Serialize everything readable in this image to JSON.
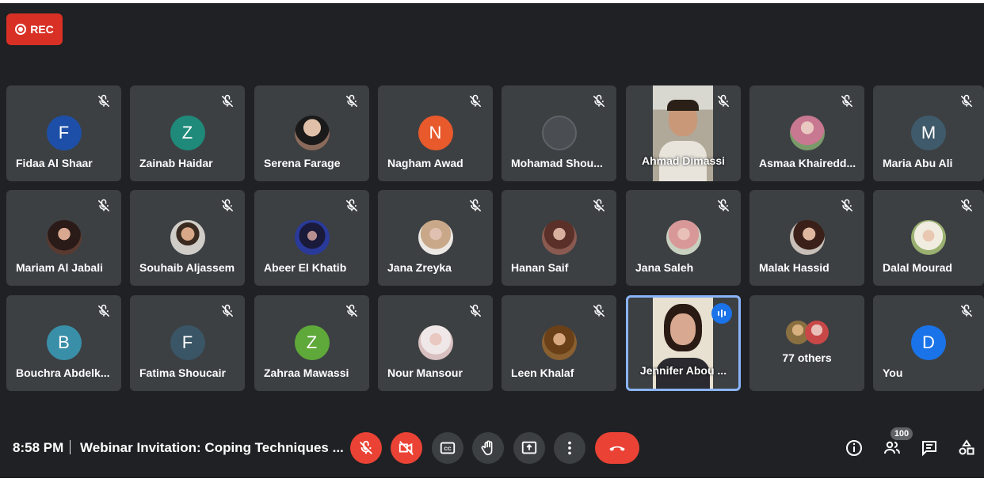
{
  "recording": {
    "label": "REC"
  },
  "participants": [
    {
      "name": "Fidaa Al Shaar",
      "avatar_letter": "F",
      "color": "#1e4fa8",
      "kind": "letter"
    },
    {
      "name": "Zainab Haidar",
      "avatar_letter": "Z",
      "color": "#1f8a7a",
      "kind": "letter"
    },
    {
      "name": "Serena Farage",
      "kind": "photo",
      "photo_color": "#8a6a5a"
    },
    {
      "name": "Nagham Awad",
      "avatar_letter": "N",
      "color": "#e8592c",
      "kind": "letter"
    },
    {
      "name": "Mohamad Shou...",
      "kind": "blank",
      "color": "#4a4d51"
    },
    {
      "name": "Ahmad Dimassi",
      "kind": "video"
    },
    {
      "name": "Asmaa Khairedd...",
      "kind": "photo",
      "photo_color": "#7a9a6a"
    },
    {
      "name": "Maria Abu Ali",
      "avatar_letter": "M",
      "color": "#3f5a6a",
      "kind": "letter"
    },
    {
      "name": "Mariam Al Jabali",
      "kind": "photo",
      "photo_color": "#5a3a30"
    },
    {
      "name": "Souhaib Aljassem",
      "kind": "photo",
      "photo_color": "#d0cdc8"
    },
    {
      "name": "Abeer El Khatib",
      "kind": "photo",
      "photo_color": "#2a3a9a"
    },
    {
      "name": "Jana Zreyka",
      "kind": "photo",
      "photo_color": "#d8c4b8"
    },
    {
      "name": "Hanan Saif",
      "kind": "photo",
      "photo_color": "#8a5a50"
    },
    {
      "name": "Jana Saleh",
      "kind": "photo",
      "photo_color": "#c8a098"
    },
    {
      "name": "Malak Hassid",
      "kind": "photo",
      "photo_color": "#6a5040"
    },
    {
      "name": "Dalal Mourad",
      "kind": "photo",
      "photo_color": "#c8c0a0"
    },
    {
      "name": "Bouchra Abdelk...",
      "avatar_letter": "B",
      "color": "#3a8fa8",
      "kind": "letter"
    },
    {
      "name": "Fatima Shoucair",
      "avatar_letter": "F",
      "color": "#3a5565",
      "kind": "letter"
    },
    {
      "name": "Zahraa Mawassi",
      "avatar_letter": "Z",
      "color": "#5fa83a",
      "kind": "letter"
    },
    {
      "name": "Nour Mansour",
      "kind": "photo",
      "photo_color": "#d8c0c0"
    },
    {
      "name": "Leen Khalaf",
      "kind": "photo",
      "photo_color": "#8a6030"
    },
    {
      "name": "Jennifer Abou ...",
      "kind": "video-speaking"
    },
    {
      "name": "77 others",
      "kind": "others"
    },
    {
      "name": "You",
      "avatar_letter": "D",
      "color": "#1a73e8",
      "kind": "letter"
    }
  ],
  "footer": {
    "time": "8:58 PM",
    "meeting_title": "Webinar Invitation: Coping Techniques ...",
    "participant_count": "100"
  },
  "controls": [
    "mic-off",
    "camera-off",
    "captions",
    "raise-hand",
    "present",
    "more-options",
    "end-call"
  ],
  "right_icons": [
    "info",
    "people",
    "chat",
    "activities"
  ]
}
